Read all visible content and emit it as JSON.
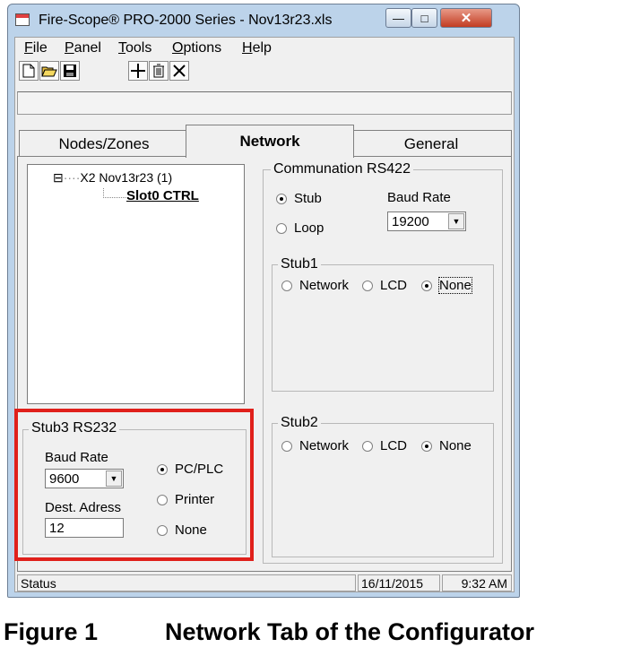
{
  "window": {
    "title": "Fire-Scope® PRO-2000 Series - Nov13r23.xls",
    "controls": {
      "minimize": "—",
      "maximize": "□",
      "close": "✕"
    }
  },
  "menu": [
    {
      "accel": "F",
      "rest": "ile"
    },
    {
      "accel": "P",
      "rest": "anel"
    },
    {
      "accel": "T",
      "rest": "ools"
    },
    {
      "accel": "O",
      "rest": "ptions"
    },
    {
      "accel": "H",
      "rest": "elp"
    }
  ],
  "toolbar": {
    "new_icon": "new-file-icon",
    "open_icon": "open-folder-icon",
    "save_icon": "save-disk-icon",
    "add_icon": "plus-icon",
    "delete_icon": "trash-icon",
    "remove_icon": "x-icon"
  },
  "tabs": [
    {
      "label": "Nodes/Zones",
      "active": false
    },
    {
      "label": "Network",
      "active": true
    },
    {
      "label": "General",
      "active": false
    }
  ],
  "tree": {
    "root_toggle": "⊟",
    "root": "X2 Nov13r23 (1)",
    "child": "Slot0 CTRL"
  },
  "communication": {
    "title": "Communation RS422",
    "mode_options": [
      "Stub",
      "Loop"
    ],
    "mode_selected": "Stub",
    "baud_label": "Baud Rate",
    "baud_value": "19200",
    "stub1": {
      "title": "Stub1",
      "options": [
        "Network",
        "LCD",
        "None"
      ],
      "selected": "None"
    },
    "stub2": {
      "title": "Stub2",
      "options": [
        "Network",
        "LCD",
        "None"
      ],
      "selected": "None"
    }
  },
  "stub3": {
    "title": "Stub3  RS232",
    "baud_label": "Baud Rate",
    "baud_value": "9600",
    "dest_label": "Dest. Adress",
    "dest_value": "12",
    "options": [
      "PC/PLC",
      "Printer",
      "None"
    ],
    "selected": "PC/PLC",
    "highlight_color": "#e0201b"
  },
  "status": {
    "text": "Status",
    "date": "16/11/2015",
    "time": "9:32 AM"
  },
  "caption": {
    "number": "Figure 1",
    "text": "Network Tab of the Configurator"
  }
}
